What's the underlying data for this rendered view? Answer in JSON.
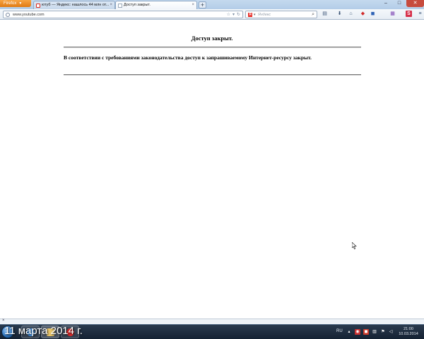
{
  "browser": {
    "menu_button": "Firefox",
    "tabs": [
      {
        "title": "ютуб — Яндекс: нашлось 44 млн от...",
        "active": false
      },
      {
        "title": "Доступ закрыт.",
        "active": true
      }
    ],
    "new_tab": "+",
    "window_controls": {
      "minimize": "–",
      "maximize": "□",
      "close": "✕"
    },
    "url": "www.youtube.com",
    "search": {
      "engine_logo": "Я",
      "placeholder": "Яндекс"
    }
  },
  "page": {
    "title": "Доступ закрыт.",
    "message": "В соответствии с требованиями законодательства доступ к запрашиваемому Интернет-ресурсу закрыт."
  },
  "statusbar": {
    "close": "×"
  },
  "taskbar": {
    "date_overlay": "11 марта 2014 г.",
    "language": "RU",
    "clock_time": "21:00",
    "clock_date": "10.03.2014"
  },
  "colors": {
    "firefox_orange": "#e8871e",
    "close_red": "#c74b3d",
    "taskbar": "#1e2d40"
  }
}
